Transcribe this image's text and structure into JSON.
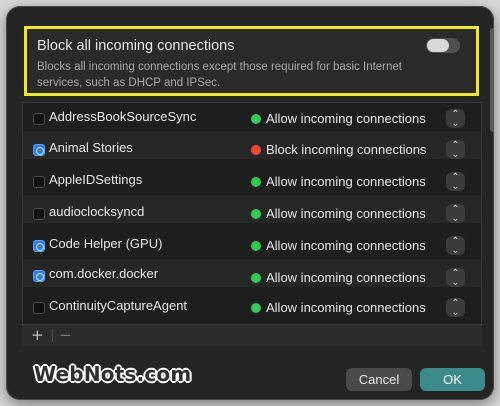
{
  "block_incoming": {
    "title": "Block all incoming connections",
    "description": "Blocks all incoming connections except those required for basic Internet services, such as DHCP and IPSec.",
    "toggle_on": false
  },
  "apps": [
    {
      "name": "AddressBookSourceSync",
      "icon": "generic-app-icon",
      "status": "Allow incoming connections",
      "status_color": "#34c759"
    },
    {
      "name": "Animal Stories",
      "icon": "globe-app-icon",
      "status": "Block incoming connections",
      "status_color": "#ff453a"
    },
    {
      "name": "AppleIDSettings",
      "icon": "generic-app-icon",
      "status": "Allow incoming connections",
      "status_color": "#34c759"
    },
    {
      "name": "audioclocksyncd",
      "icon": "generic-app-icon",
      "status": "Allow incoming connections",
      "status_color": "#34c759"
    },
    {
      "name": "Code Helper (GPU)",
      "icon": "globe-app-icon",
      "status": "Allow incoming connections",
      "status_color": "#34c759"
    },
    {
      "name": "com.docker.docker",
      "icon": "globe-app-icon",
      "status": "Allow incoming connections",
      "status_color": "#34c759"
    },
    {
      "name": "ContinuityCaptureAgent",
      "icon": "generic-app-icon",
      "status": "Allow incoming connections",
      "status_color": "#34c759"
    }
  ],
  "list_footer": {
    "add_label": "+",
    "remove_label": "−"
  },
  "buttons": {
    "cancel": "Cancel",
    "ok": "OK"
  },
  "watermark": "WebNots.com",
  "colors": {
    "accent": "#3a8b8c",
    "highlight": "#f2ea21"
  }
}
